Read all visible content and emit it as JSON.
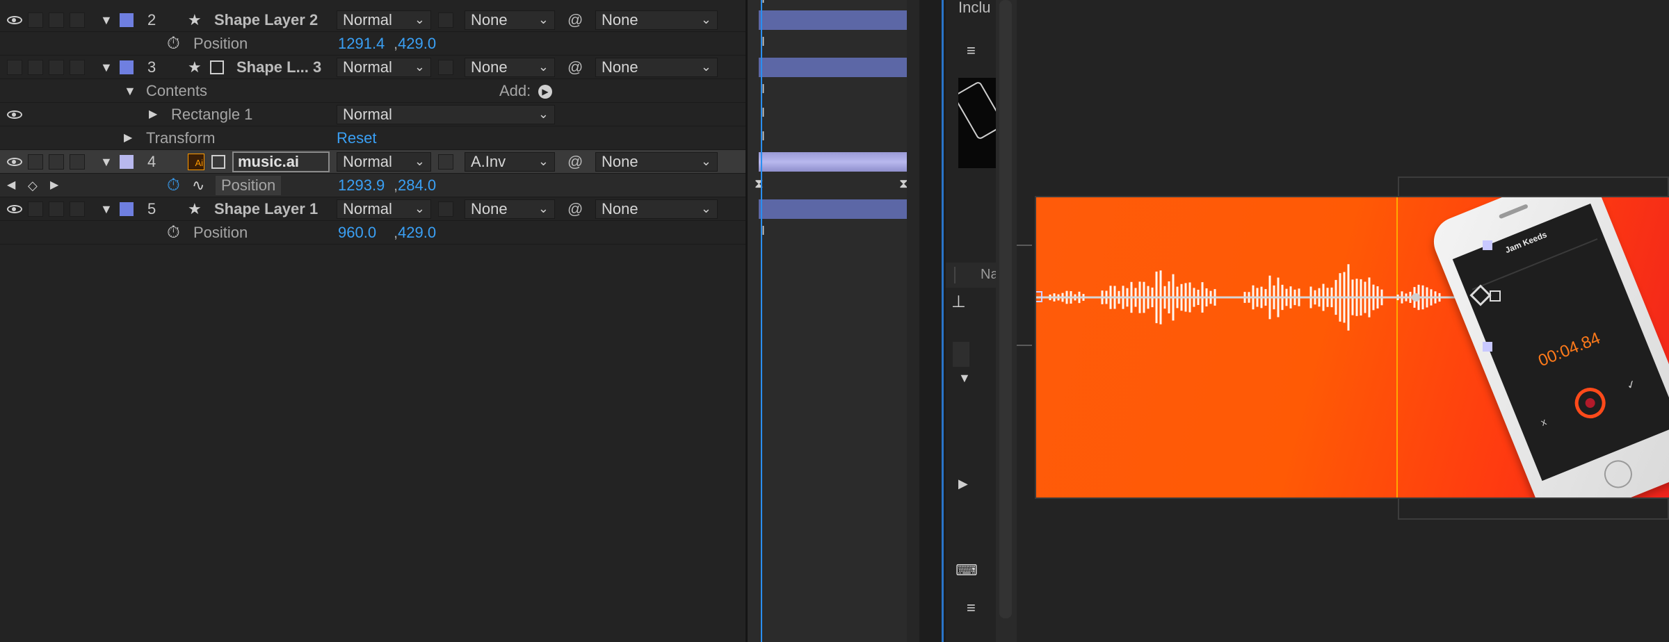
{
  "layers": [
    {
      "index": "2",
      "name": "Shape Layer 2",
      "mode": "Normal",
      "trkmat": "None",
      "parent": "None",
      "color": "#6f7fe0",
      "prop": {
        "label": "Position",
        "x": "1291.4",
        "y": "429.0"
      }
    },
    {
      "index": "3",
      "name": "Shape L... 3",
      "mode": "Normal",
      "trkmat": "None",
      "parent": "None",
      "color": "#6f7fe0",
      "contents_label": "Contents",
      "add_label": "Add:",
      "rect_label": "Rectangle 1",
      "rect_mode": "Normal",
      "transform_label": "Transform",
      "reset_label": "Reset"
    },
    {
      "index": "4",
      "name": "music.ai",
      "mode": "Normal",
      "trkmat": "A.Inv",
      "parent": "None",
      "color": "#b8b8ee",
      "prop": {
        "label": "Position",
        "x": "1293.9",
        "y": "284.0"
      }
    },
    {
      "index": "5",
      "name": "Shape Layer 1",
      "mode": "Normal",
      "trkmat": "None",
      "parent": "None",
      "color": "#6f7fe0",
      "prop": {
        "label": "Position",
        "x": "960.0",
        "y": "429.0"
      }
    }
  ],
  "ai_badge": "Ai",
  "project": {
    "title": "Inclu",
    "col_name": "Na"
  },
  "phone": {
    "screen_title": "Jam Keeds",
    "time": "00:04.84",
    "cancel": "x",
    "confirm": "✓"
  },
  "colors": {
    "accent_blue": "#3aa0f5",
    "layer_bar": "#5c67a6",
    "frame_orange": "#ff5b0a"
  }
}
